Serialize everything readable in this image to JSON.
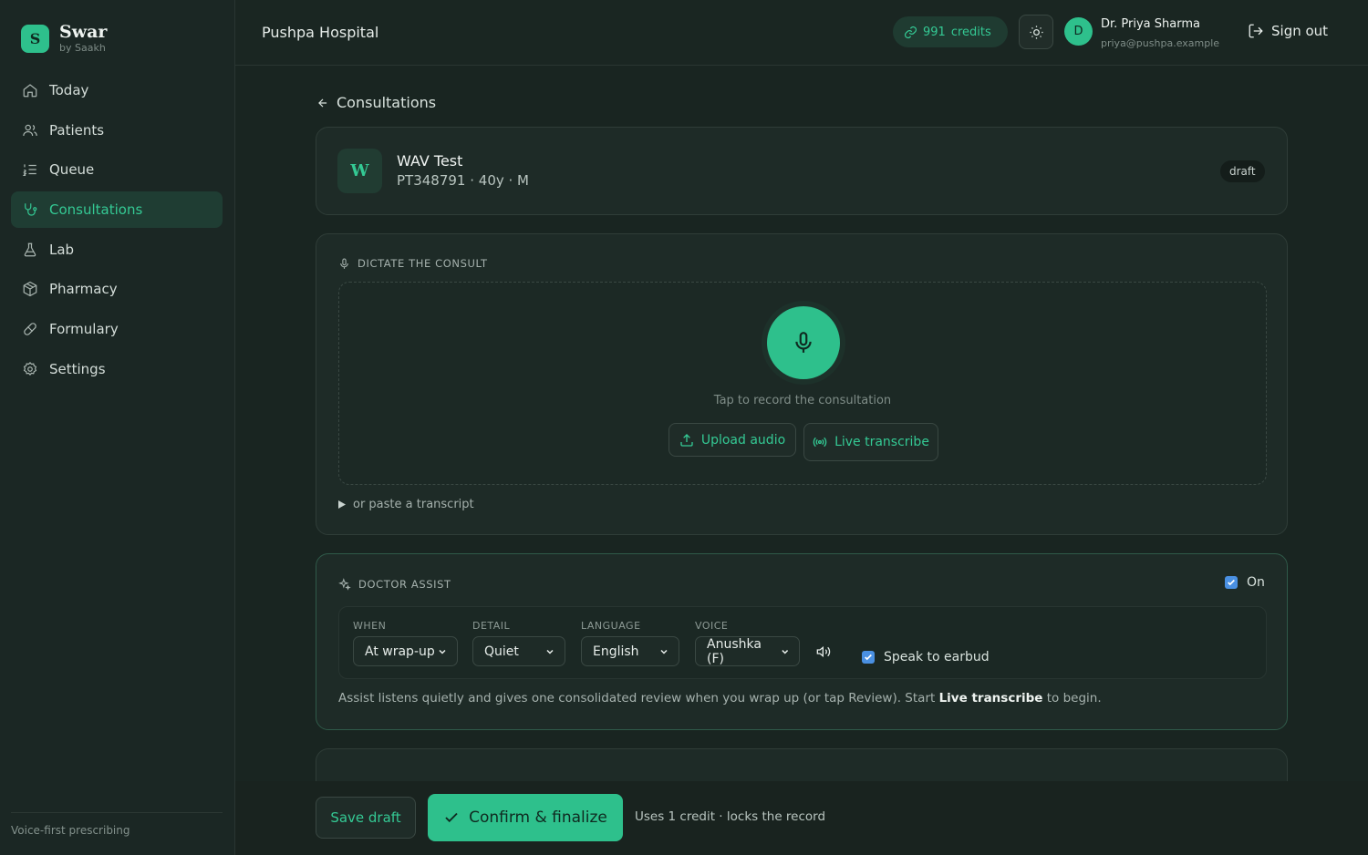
{
  "brand": {
    "logo_letter": "S",
    "name": "Swar",
    "sub": "by Saakh"
  },
  "nav": [
    {
      "label": "Today",
      "icon": "home-icon"
    },
    {
      "label": "Patients",
      "icon": "users-icon"
    },
    {
      "label": "Queue",
      "icon": "list-ordered-icon"
    },
    {
      "label": "Consultations",
      "icon": "stethoscope-icon",
      "active": true
    },
    {
      "label": "Lab",
      "icon": "flask-icon"
    },
    {
      "label": "Pharmacy",
      "icon": "package-icon"
    },
    {
      "label": "Formulary",
      "icon": "pill-icon"
    },
    {
      "label": "Settings",
      "icon": "gear-icon"
    }
  ],
  "sidebar_footer": "Voice-first prescribing",
  "header": {
    "hospital": "Pushpa Hospital",
    "credits_value": "991",
    "credits_label": "credits",
    "user_initial": "D",
    "user_name": "Dr. Priya Sharma",
    "user_email": "priya@pushpa.example",
    "sign_out": "Sign out"
  },
  "breadcrumb": {
    "back_label": "Consultations"
  },
  "patient": {
    "initial": "W",
    "name": "WAV Test",
    "meta": "PT348791 · 40y · M",
    "status": "draft"
  },
  "dictate": {
    "title": "DICTATE THE CONSULT",
    "tap_label": "Tap to record the consultation",
    "upload_label": "Upload audio",
    "live_label": "Live transcribe",
    "paste_label": "or paste a transcript"
  },
  "assist": {
    "title": "DOCTOR ASSIST",
    "toggle_label": "On",
    "toggle_checked": true,
    "when_label": "WHEN",
    "when_value": "At wrap-up",
    "detail_label": "DETAIL",
    "detail_value": "Quiet",
    "language_label": "LANGUAGE",
    "language_value": "English",
    "voice_label": "VOICE",
    "voice_value": "Anushka (F)",
    "earbud_label": "Speak to earbud",
    "earbud_checked": true,
    "note_prefix": "Assist listens quietly and gives one consolidated review when you wrap up (or tap Review). Start ",
    "note_bold": "Live transcribe",
    "note_suffix": " to begin."
  },
  "actions": {
    "save_draft": "Save draft",
    "confirm": "Confirm & finalize",
    "confirm_note": "Uses 1 credit · locks the record"
  },
  "colors": {
    "accent": "#2ec08c",
    "accent_text": "#34c994",
    "background": "#192521",
    "card": "#1e2b27",
    "checkbox": "#4a90e2"
  }
}
